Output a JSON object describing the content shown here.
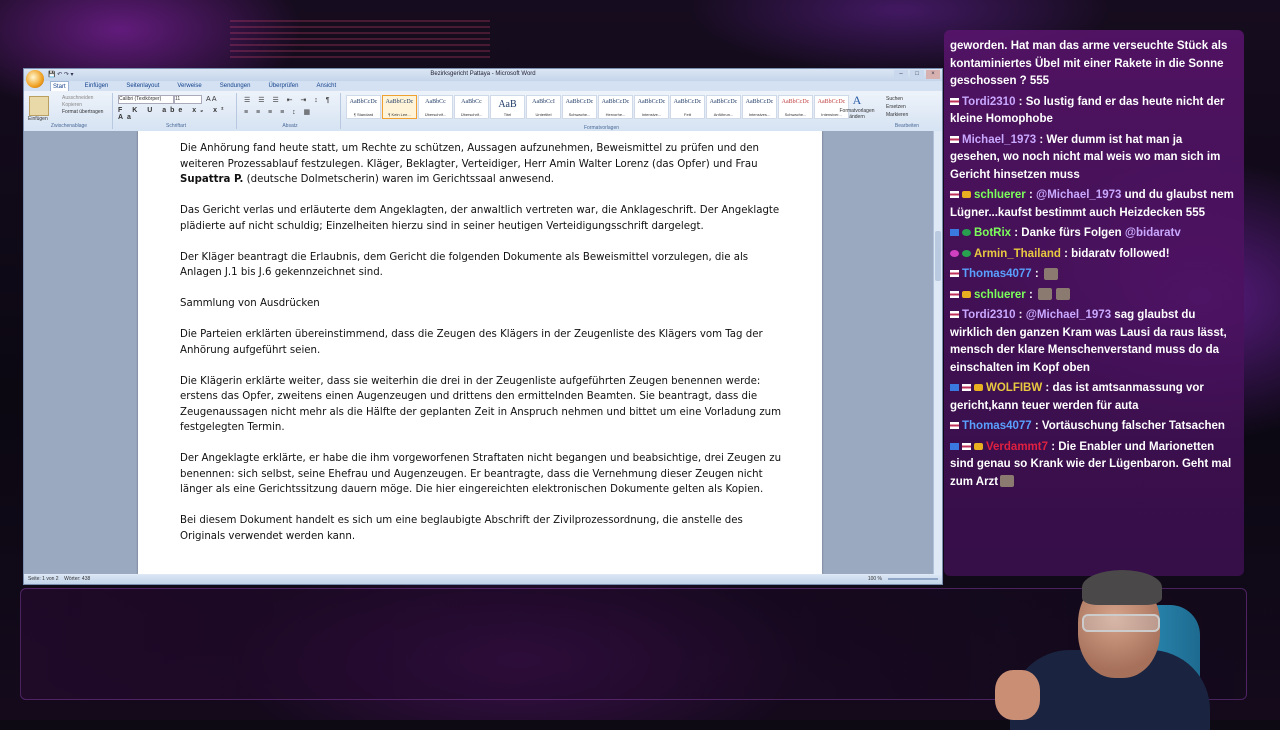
{
  "word": {
    "title": "Bezirksgericht Pattaya - Microsoft Word",
    "tabs": [
      "Start",
      "Einfügen",
      "Seitenlayout",
      "Verweise",
      "Sendungen",
      "Überprüfen",
      "Ansicht"
    ],
    "clipboard": {
      "paste": "Einfügen",
      "cut": "Ausschneiden",
      "copy": "Kopieren",
      "format": "Format übertragen",
      "label": "Zwischenablage"
    },
    "font": {
      "name": "Calibri (Textkörper)",
      "size": "11",
      "label": "Schriftart"
    },
    "paragraph_label": "Absatz",
    "styles_label": "Formatvorlagen",
    "styles": [
      {
        "preview": "AaBbCcDc",
        "name": "¶ Standard"
      },
      {
        "preview": "AaBbCcDc",
        "name": "¶ Kein Lee..."
      },
      {
        "preview": "AaBbCc",
        "name": "Überschrif..."
      },
      {
        "preview": "AaBbCc",
        "name": "Überschrif..."
      },
      {
        "preview": "AaB",
        "name": "Titel"
      },
      {
        "preview": "AaBbCcI",
        "name": "Untertitel"
      },
      {
        "preview": "AaBbCcDc",
        "name": "Schwache..."
      },
      {
        "preview": "AaBbCcDc",
        "name": "Hervorhe..."
      },
      {
        "preview": "AaBbCcDc",
        "name": "Intensive..."
      },
      {
        "preview": "AaBbCcDc",
        "name": "Fett"
      },
      {
        "preview": "AaBbCcDc",
        "name": "Anführun..."
      },
      {
        "preview": "AaBbCcDc",
        "name": "Intensives..."
      },
      {
        "preview": "AaBbCcDc",
        "name": "Schwache..."
      },
      {
        "preview": "AaBbCcDc",
        "name": "Intensiver..."
      }
    ],
    "change_styles": "Formatvorlagen ändern",
    "editing": {
      "find": "Suchen",
      "replace": "Ersetzen",
      "select": "Markieren",
      "label": "Bearbeiten"
    },
    "paragraphs": [
      [
        "Die Anhörung fand heute statt, um Rechte zu schützen, Aussagen aufzunehmen, Beweismittel zu prüfen und den weiteren Prozessablauf festzulegen. Kläger, Beklagter, Verteidiger, Herr Amin Walter Lorenz (das Opfer) und Frau ",
        "Supattra P.",
        " (deutsche Dolmetscherin) waren im Gerichtssaal anwesend."
      ],
      "Das Gericht verlas und erläuterte dem Angeklagten, der anwaltlich vertreten war, die Anklageschrift. Der Angeklagte plädierte auf nicht schuldig; Einzelheiten hierzu sind in seiner heutigen Verteidigungsschrift dargelegt.",
      "Der Kläger beantragt die Erlaubnis, dem Gericht die folgenden Dokumente als Beweismittel vorzulegen, die als Anlagen J.1 bis J.6 gekennzeichnet sind.",
      "Sammlung von Ausdrücken",
      "Die Parteien erklärten übereinstimmend, dass die Zeugen des Klägers in der Zeugenliste des Klägers vom Tag der Anhörung aufgeführt seien.",
      "Die Klägerin erklärte weiter, dass sie weiterhin die drei in der Zeugenliste aufgeführten Zeugen benennen werde: erstens das Opfer, zweitens einen Augenzeugen und drittens den ermittelnden Beamten. Sie beantragt, dass die Zeugenaussagen nicht mehr als die Hälfte der geplanten Zeit in Anspruch nehmen und bittet um eine Vorladung zum festgelegten Termin.",
      "Der Angeklagte erklärte, er habe die ihm vorgeworfenen Straftaten nicht begangen und beabsichtige, drei Zeugen zu benennen: sich selbst, seine Ehefrau und Augenzeugen. Er beantragte, dass die Vernehmung dieser Zeugen nicht länger als eine Gerichtssitzung dauern möge. Die hier eingereichten elektronischen Dokumente gelten als Kopien.",
      "Bei diesem Dokument handelt es sich um eine beglaubigte Abschrift der Zivilprozessordnung, die anstelle des Originals verwendet werden kann."
    ],
    "status": {
      "page": "Seite: 1 von 2",
      "words": "Wörter: 438",
      "zoom": "100 %"
    }
  },
  "chat": {
    "messages": [
      {
        "user": "",
        "text": "geworden. Hat man das arme verseuchte Stück als kontaminiertes Übel mit einer Rakete in die Sonne geschossen ? 555",
        "badges": []
      },
      {
        "user": "Tordi2310",
        "color": "#c9a8ff",
        "text": "So lustig fand er das heute nicht der kleine Homophobe",
        "badges": [
          "de"
        ]
      },
      {
        "user": "Michael_1973",
        "color": "#c9a8ff",
        "text": "Wer dumm ist hat man ja gesehen, wo noch nicht mal weis wo man sich im Gericht hinsetzen muss",
        "badges": [
          "de"
        ]
      },
      {
        "user": "schluerer",
        "color": "#7cff5a",
        "mention": "@Michael_1973",
        "text": "und du glaubst nem Lügner...kaufst bestimmt auch Heizdecken 555",
        "badges": [
          "de",
          "sub"
        ]
      },
      {
        "user": "BotRix",
        "color": "#7cff5a",
        "text": "Danke fürs Folgen",
        "mention_after": "@bidaratv",
        "badges": [
          "bot",
          "mod"
        ]
      },
      {
        "user": "Armin_Thailand",
        "color": "#e8c840",
        "text": "bidaratv followed!",
        "badges": [
          "pin",
          "mod"
        ]
      },
      {
        "user": "Thomas4077",
        "color": "#5aa0ff",
        "text": "",
        "emotes": 1,
        "badges": [
          "de"
        ]
      },
      {
        "user": "schluerer",
        "color": "#7cff5a",
        "text": "",
        "emotes": 2,
        "badges": [
          "de",
          "sub"
        ]
      },
      {
        "user": "Tordi2310",
        "color": "#c9a8ff",
        "mention": "@Michael_1973",
        "text": "sag glaubst du wirklich den ganzen Kram was Lausi da raus lässt, mensch der klare Menschenverstand muss do da einschalten im Kopf oben",
        "badges": [
          "de"
        ]
      },
      {
        "user": "WOLFIBW",
        "color": "#e8c840",
        "text": "das ist amtsanmassung vor gericht,kann teuer werden für auta",
        "badges": [
          "bot",
          "de",
          "sub"
        ]
      },
      {
        "user": "Thomas4077",
        "color": "#5aa0ff",
        "text": "Vortäuschung falscher Tatsachen",
        "badges": [
          "de"
        ]
      },
      {
        "user": "Verdammt7",
        "color": "#e02040",
        "text": "Die Enabler und Marionetten sind genau so Krank wie der Lügenbaron. Geht mal zum Arzt",
        "emotes_after": 1,
        "badges": [
          "bot",
          "de",
          "sub"
        ]
      }
    ]
  }
}
